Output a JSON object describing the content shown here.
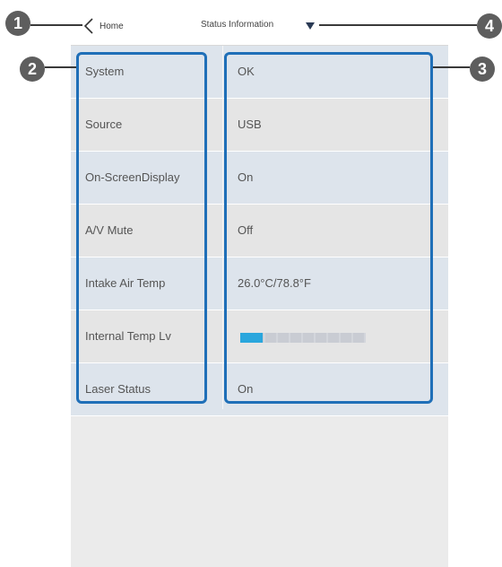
{
  "header": {
    "back_label": "Home",
    "title": "Status Information"
  },
  "callouts": [
    "1",
    "2",
    "3",
    "4"
  ],
  "rows": [
    {
      "label": "System",
      "value": "OK"
    },
    {
      "label": "Source",
      "value": "USB"
    },
    {
      "label": "On-ScreenDisplay",
      "value": "On"
    },
    {
      "label": "A/V Mute",
      "value": "Off"
    },
    {
      "label": "Intake Air Temp",
      "value": "26.0°C/78.8°F"
    },
    {
      "label": "Internal Temp Lv",
      "value": "",
      "level_fraction": 0.18
    },
    {
      "label": "Laser Status",
      "value": "On"
    }
  ],
  "colors": {
    "accent": "#1f6fb8",
    "level_bar": "#2aa6dd"
  },
  "icons": [
    "chevron-left-icon",
    "dropdown-triangle-icon"
  ]
}
